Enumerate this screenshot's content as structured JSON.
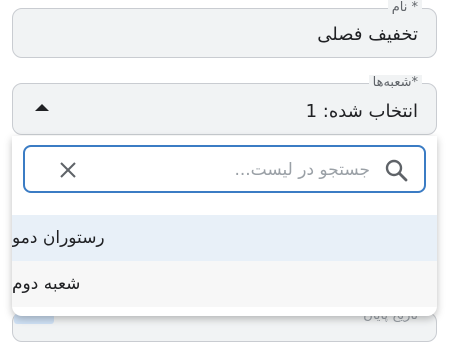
{
  "name_field": {
    "label": "نام *",
    "value": "تخفیف فصلی"
  },
  "branches_field": {
    "label": "شعبه‌ها*",
    "value": "انتخاب شده: 1",
    "caret_icon": "caret-up-icon"
  },
  "dropdown": {
    "search": {
      "placeholder": "جستجو در لیست...",
      "value": "",
      "search_icon": "search-icon",
      "clear_icon": "close-icon"
    },
    "items": [
      {
        "label": "رستوران دمو",
        "highlighted": true
      },
      {
        "label": "شعبه دوم",
        "highlighted": false
      }
    ]
  },
  "partially_hidden_field": {
    "label": "تاریخ پایان"
  },
  "colors": {
    "field_background": "#f1f3f4",
    "focus_border": "#3b7cc4",
    "highlight_row": "#e8f0f8"
  }
}
